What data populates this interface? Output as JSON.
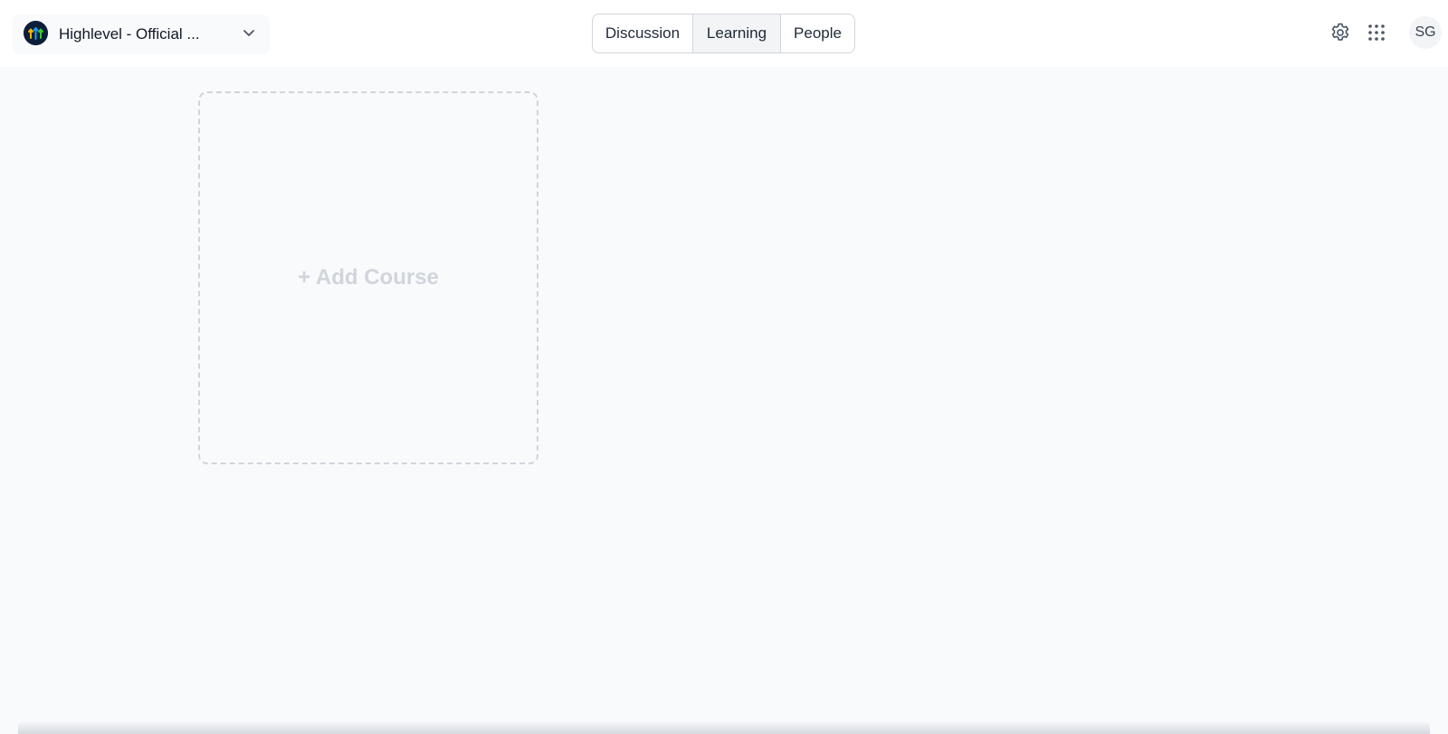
{
  "header": {
    "community_name": "Highlevel - Official ...",
    "logo_icon": "community-logo-icon",
    "chevron_icon": "chevron-down-icon",
    "tabs": [
      {
        "label": "Discussion",
        "active": false
      },
      {
        "label": "Learning",
        "active": true
      },
      {
        "label": "People",
        "active": false
      }
    ],
    "settings_icon": "gear-icon",
    "apps_icon": "grid-dots-icon",
    "avatar_initials": "SG"
  },
  "main": {
    "add_course_label": "+ Add Course"
  },
  "colors": {
    "page_background": "#f8fafc",
    "active_tab_background": "#f3f4f6",
    "dashed_border": "#d1d5db",
    "logo_background": "#0b1f3a"
  }
}
